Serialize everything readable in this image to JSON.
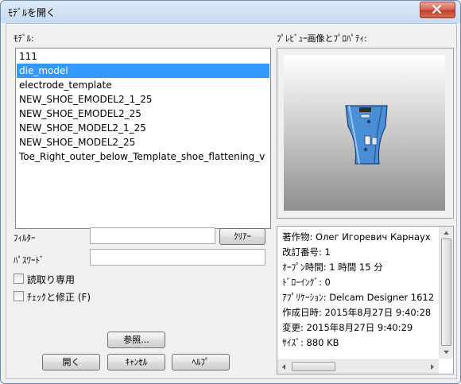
{
  "window": {
    "title": "ﾓﾃﾞﾙを開く"
  },
  "models": {
    "label": "ﾓﾃﾞﾙ:",
    "items": [
      "111",
      "die_model",
      "electrode_template",
      "NEW_SHOE_EMODEL2_1_25",
      "NEW_SHOE_EMODEL2_25",
      "NEW_SHOE_MODEL2_1_25",
      "NEW_SHOE_MODEL2_25",
      "Toe_Right_outer_below_Template_shoe_flattening_v"
    ],
    "selected": "die_model"
  },
  "filter": {
    "label": "ﾌｨﾙﾀｰ",
    "value": "",
    "clear_label": "ｸﾘｱｰ"
  },
  "password": {
    "label": "ﾊﾟｽﾜｰﾄﾞ",
    "value": ""
  },
  "readonly_checkbox": {
    "label": "読取り専用",
    "checked": false
  },
  "check_fix_checkbox": {
    "label": "ﾁｪｯｸと修正 (F)",
    "checked": false
  },
  "buttons": {
    "browse": "参照...",
    "open": "開く",
    "cancel": "ｷｬﾝｾﾙ",
    "help": "ﾍﾙﾌﾟ"
  },
  "preview": {
    "label": "ﾌﾟﾚﾋﾞｭｰ画像とﾌﾟﾛﾊﾟﾃｨ:"
  },
  "properties": [
    "著作物: Олег Игоревич Карнаух",
    "改訂番号: 1",
    "ｵｰﾌﾟﾝ時間: 1 時間 15 分",
    "ﾄﾞﾛｰｲﾝｸﾞ: 0",
    "ｱﾌﾟﾘｹｰｼｮﾝ: Delcam Designer 1612",
    "作成日時: 2015年8月27日 9:40:28",
    "変更: 2015年8月27日 9:40:29",
    "ｻｲｽﾞ: 880 KB"
  ],
  "colors": {
    "selection": "#3399ff",
    "part_fill": "#4a8fd6"
  },
  "icons": {
    "close": "close-icon"
  }
}
